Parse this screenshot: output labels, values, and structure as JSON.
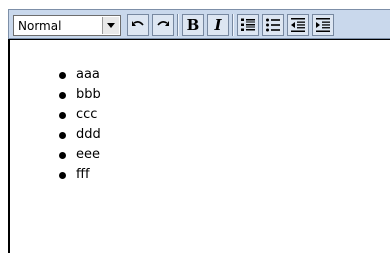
{
  "toolbar": {
    "format_select": {
      "value": "Normal"
    },
    "buttons": {
      "undo": "undo-icon",
      "redo": "redo-icon",
      "bold": "B",
      "italic": "I",
      "ordered_list": "ordered-list-icon",
      "unordered_list": "unordered-list-icon",
      "outdent": "outdent-icon",
      "indent": "indent-icon"
    },
    "colors": {
      "background": "#c9d8ec",
      "button": "#dde6f2",
      "border": "#7788a0"
    }
  },
  "editor": {
    "list_items": [
      "aaa",
      "bbb",
      "ccc",
      "ddd",
      "eee",
      "fff"
    ]
  }
}
